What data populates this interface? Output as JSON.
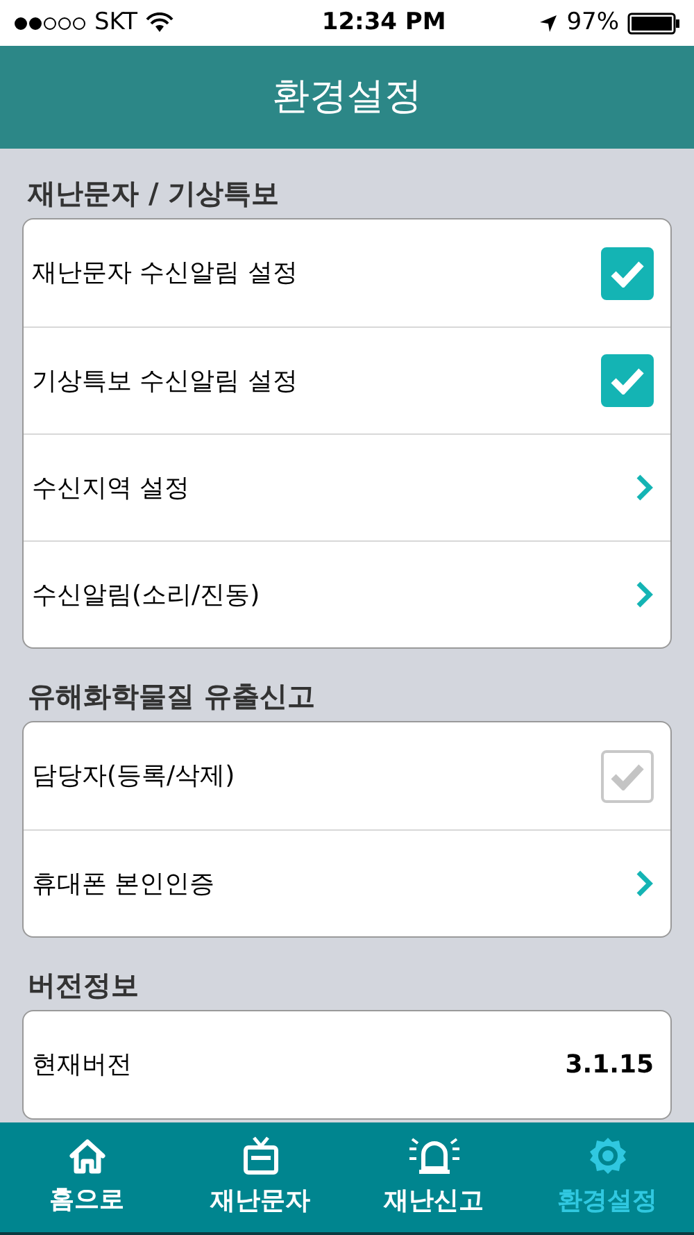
{
  "status_bar": {
    "carrier": "SKT",
    "time": "12:34 PM",
    "battery": "97%"
  },
  "header": {
    "title": "환경설정"
  },
  "sections": [
    {
      "title": "재난문자 / 기상특보",
      "rows": [
        {
          "kind": "checkbox",
          "label": "재난문자 수신알림 설정",
          "checked": true,
          "disabled": false
        },
        {
          "kind": "checkbox",
          "label": "기상특보 수신알림 설정",
          "checked": true,
          "disabled": false
        },
        {
          "kind": "link",
          "label": "수신지역 설정"
        },
        {
          "kind": "link",
          "label": "수신알림(소리/진동)"
        }
      ]
    },
    {
      "title": "유해화학물질 유출신고",
      "rows": [
        {
          "kind": "checkbox",
          "label": "담당자(등록/삭제)",
          "checked": true,
          "disabled": true
        },
        {
          "kind": "link",
          "label": "휴대폰 본인인증"
        }
      ]
    },
    {
      "title": "버전정보",
      "rows": [
        {
          "kind": "value",
          "label": "현재버전",
          "value": "3.1.15"
        }
      ]
    }
  ],
  "tab_bar": [
    {
      "kind": "home",
      "label": "홈으로",
      "selected": false
    },
    {
      "kind": "tv",
      "label": "재난문자",
      "selected": false
    },
    {
      "kind": "siren",
      "label": "재난신고",
      "selected": false
    },
    {
      "kind": "gear",
      "label": "환경설정",
      "selected": true
    }
  ]
}
